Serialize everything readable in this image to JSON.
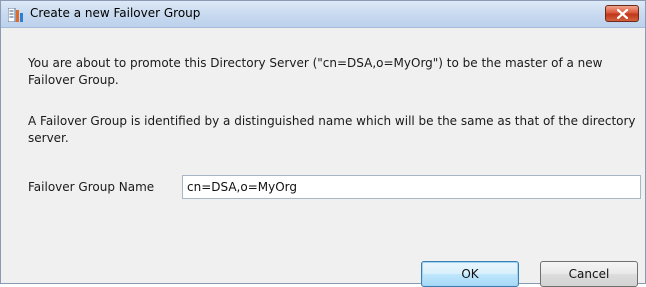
{
  "window": {
    "title": "Create a new Failover Group",
    "icon": "app-menu-icon",
    "close_icon": "close-icon"
  },
  "message": {
    "paragraph1": "You are about to promote this Directory Server (\"cn=DSA,o=MyOrg\") to be the master of a new Failover Group.",
    "paragraph2": "A Failover Group is identified by a distinguished name which will be the same as that of the directory server."
  },
  "form": {
    "name_label": "Failover Group Name",
    "name_value": "cn=DSA,o=MyOrg"
  },
  "buttons": {
    "ok_label": "OK",
    "cancel_label": "Cancel"
  },
  "colors": {
    "title_bar": "#c9daf0",
    "close_button": "#d9583a",
    "dialog_background": "#f0f0f0",
    "default_button_border": "#3c7fb1"
  }
}
